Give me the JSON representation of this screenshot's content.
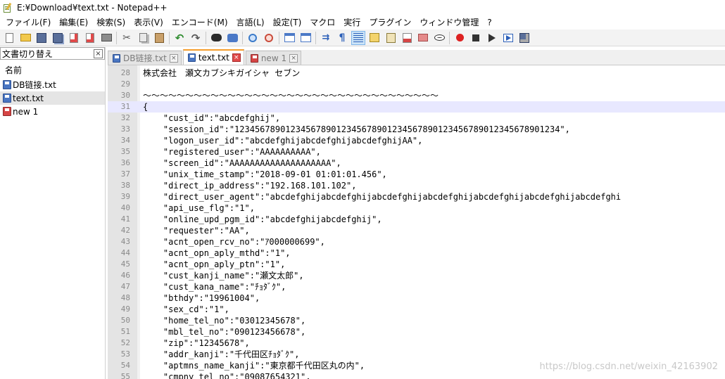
{
  "window": {
    "title": "E:¥Download¥text.txt - Notepad++"
  },
  "menu": [
    "ファイル(F)",
    "編集(E)",
    "検索(S)",
    "表示(V)",
    "エンコード(M)",
    "言語(L)",
    "設定(T)",
    "マクロ",
    "実行",
    "プラグイン",
    "ウィンドウ管理",
    "?"
  ],
  "toolbar": {
    "icons": [
      "new-file",
      "open-file",
      "save",
      "save-all",
      "close",
      "close-all",
      "print",
      "sep",
      "cut",
      "copy",
      "paste",
      "sep",
      "undo",
      "redo",
      "sep",
      "find",
      "replace",
      "sep",
      "zoom-in",
      "zoom-out",
      "sep",
      "sync-vertical",
      "sync-horizontal",
      "sep",
      "word-wrap",
      "show-all-chars",
      "indent-guide",
      "user-language",
      "doc-map",
      "function-list",
      "folder-workspace",
      "monitoring",
      "sep",
      "macro-record",
      "macro-stop",
      "macro-play",
      "macro-run-multiple",
      "macro-save"
    ],
    "active_icon": "indent-guide"
  },
  "sidebar": {
    "title": "文書切り替え",
    "close_label": "×",
    "column_header": "名前",
    "files": [
      {
        "name": "DB链接.txt",
        "icon": "blue",
        "selected": false
      },
      {
        "name": "text.txt",
        "icon": "blue",
        "selected": true
      },
      {
        "name": "new 1",
        "icon": "red",
        "selected": false
      }
    ]
  },
  "tabs": [
    {
      "label": "DB链接.txt",
      "icon": "blue",
      "active": false,
      "close": "×"
    },
    {
      "label": "text.txt",
      "icon": "blue",
      "active": true,
      "close": "×"
    },
    {
      "label": "new 1",
      "icon": "red",
      "active": false,
      "close": "×"
    }
  ],
  "editor": {
    "current_line": 31,
    "lines": [
      {
        "n": "28",
        "text": "株式会社　瀬文カブシキガイシャ セブン"
      },
      {
        "n": "29",
        "text": ""
      },
      {
        "n": "30",
        "text": "〜〜〜〜〜〜〜〜〜〜〜〜〜〜〜〜〜〜〜〜〜〜〜〜〜〜〜〜〜〜〜〜〜〜〜"
      },
      {
        "n": "31",
        "text": "{"
      },
      {
        "n": "32",
        "text": "    \"cust_id\":\"abcdefghij\","
      },
      {
        "n": "33",
        "text": "    \"session_id\":\"1234567890123456789012345678901234567890123456789012345678901234\","
      },
      {
        "n": "34",
        "text": "    \"logon_user_id\":\"abcdefghijabcdefghijabcdefghijAA\","
      },
      {
        "n": "35",
        "text": "    \"registered_user\":\"AAAAAAAAAA\","
      },
      {
        "n": "36",
        "text": "    \"screen_id\":\"AAAAAAAAAAAAAAAAAAAA\","
      },
      {
        "n": "37",
        "text": "    \"unix_time_stamp\":\"2018-09-01 01:01:01.456\","
      },
      {
        "n": "38",
        "text": "    \"direct_ip_address\":\"192.168.101.102\","
      },
      {
        "n": "39",
        "text": "    \"direct_user_agent\":\"abcdefghijabcdefghijabcdefghijabcdefghijabcdefghijabcdefghijabcdefghi"
      },
      {
        "n": "40",
        "text": "    \"api_use_flg\":\"1\","
      },
      {
        "n": "41",
        "text": "    \"online_upd_pgm_id\":\"abcdefghijabcdefghij\","
      },
      {
        "n": "42",
        "text": "    \"requester\":\"AA\","
      },
      {
        "n": "43",
        "text": "    \"acnt_open_rcv_no\":\"ｱ000000699\","
      },
      {
        "n": "44",
        "text": "    \"acnt_opn_aply_mthd\":\"1\","
      },
      {
        "n": "45",
        "text": "    \"acnt_opn_aply_ptn\":\"1\","
      },
      {
        "n": "46",
        "text": "    \"cust_kanji_name\":\"瀬文太郎\","
      },
      {
        "n": "47",
        "text": "    \"cust_kana_name\":\"ﾁｮﾀﾞｸ\","
      },
      {
        "n": "48",
        "text": "    \"bthdy\":\"19961004\","
      },
      {
        "n": "49",
        "text": "    \"sex_cd\":\"1\","
      },
      {
        "n": "50",
        "text": "    \"home_tel_no\":\"03012345678\","
      },
      {
        "n": "51",
        "text": "    \"mbl_tel_no\":\"090123456678\","
      },
      {
        "n": "52",
        "text": "    \"zip\":\"12345678\","
      },
      {
        "n": "53",
        "text": "    \"addr_kanji\":\"千代田区ﾁｮﾀﾞｸ\","
      },
      {
        "n": "54",
        "text": "    \"aptmns_name_kanji\":\"東京都千代田区丸の内\","
      },
      {
        "n": "55",
        "text": "    \"cmpny_tel_no\":\"09087654321\","
      }
    ]
  },
  "watermark": "https://blog.csdn.net/weixin_42163902"
}
